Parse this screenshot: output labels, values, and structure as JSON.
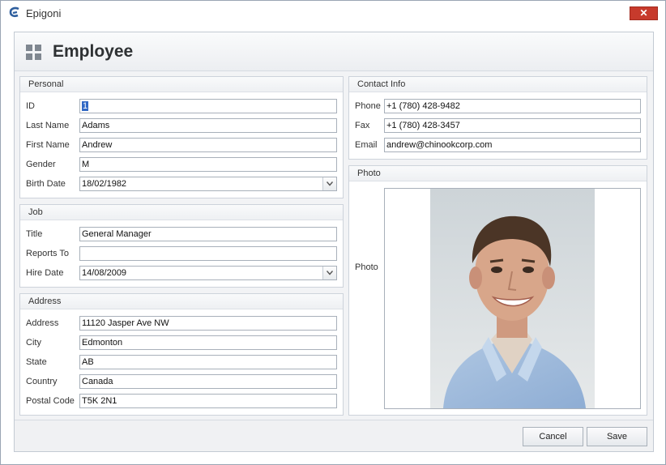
{
  "window": {
    "title": "Epigoni",
    "close_glyph": "✕"
  },
  "header": {
    "title": "Employee",
    "icon": "grid-icon"
  },
  "personal": {
    "caption": "Personal",
    "id_label": "ID",
    "id_value": "1",
    "last_name_label": "Last Name",
    "last_name_value": "Adams",
    "first_name_label": "First Name",
    "first_name_value": "Andrew",
    "gender_label": "Gender",
    "gender_value": "M",
    "birth_date_label": "Birth Date",
    "birth_date_value": "18/02/1982"
  },
  "job": {
    "caption": "Job",
    "title_label": "Title",
    "title_value": "General Manager",
    "reports_to_label": "Reports To",
    "reports_to_value": "",
    "hire_date_label": "Hire Date",
    "hire_date_value": "14/08/2009"
  },
  "address": {
    "caption": "Address",
    "address_label": "Address",
    "address_value": "11120 Jasper Ave NW",
    "city_label": "City",
    "city_value": "Edmonton",
    "state_label": "State",
    "state_value": "AB",
    "country_label": "Country",
    "country_value": "Canada",
    "postal_label": "Postal Code",
    "postal_value": "T5K 2N1"
  },
  "contact": {
    "caption": "Contact Info",
    "phone_label": "Phone",
    "phone_value": "+1 (780) 428-9482",
    "fax_label": "Fax",
    "fax_value": "+1 (780) 428-3457",
    "email_label": "Email",
    "email_value": "andrew@chinookcorp.com"
  },
  "photo": {
    "caption": "Photo",
    "label": "Photo"
  },
  "footer": {
    "cancel_label": "Cancel",
    "save_label": "Save"
  },
  "colors": {
    "accent": "#3168c4",
    "close": "#c73a2c",
    "border": "#a8b0ba"
  }
}
